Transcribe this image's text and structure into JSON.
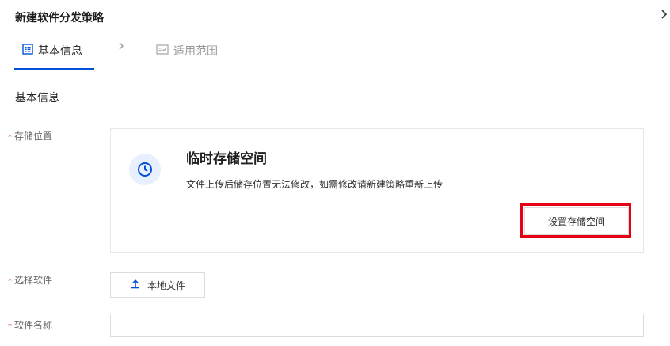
{
  "header": {
    "title": "新建软件分发策略",
    "close_icon": "chevron-right-icon"
  },
  "tabs": [
    {
      "label": "基本信息",
      "icon": "list-icon",
      "active": true
    },
    {
      "label": "适用范围",
      "icon": "checklist-card-icon",
      "active": false
    }
  ],
  "tab_separator_icon": "chevron-right-icon",
  "section": {
    "title": "基本信息"
  },
  "form": {
    "required_mark": "*",
    "storage_label": "存储位置",
    "software_label": "选择软件",
    "name_label": "软件名称",
    "name_value": ""
  },
  "storage_card": {
    "icon": "clock-icon",
    "title": "临时存储空间",
    "description": "文件上传后储存位置无法修改，如需修改请新建策略重新上传",
    "button_label": "设置存储空间"
  },
  "upload": {
    "icon": "upload-icon",
    "button_label": "本地文件"
  },
  "colors": {
    "accent": "#0052d9",
    "highlight": "#e60012",
    "required": "#e34d59",
    "icon_bg": "#e8efff"
  }
}
